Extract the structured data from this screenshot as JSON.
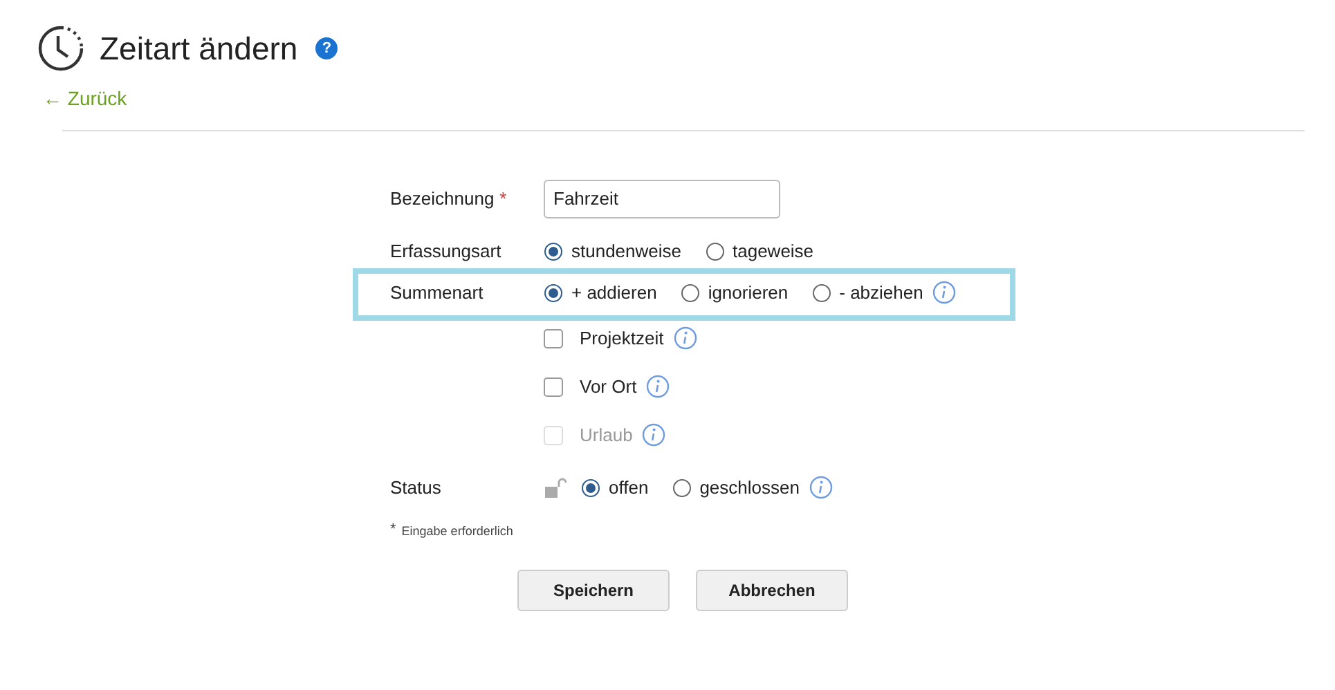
{
  "header": {
    "title": "Zeitart ändern",
    "help": "?",
    "back_link": "← Zurück"
  },
  "form": {
    "fields": [
      {
        "kind": "text",
        "label": "Bezeichnung",
        "required": true,
        "value": "Fahrzeit"
      },
      {
        "kind": "radio",
        "label": "Erfassungsart",
        "info": false,
        "options": [
          {
            "label": "stundenweise",
            "selected": true
          },
          {
            "label": "tageweise",
            "selected": false
          }
        ]
      },
      {
        "kind": "radio",
        "label": "Summenart",
        "info": true,
        "options": [
          {
            "label": "+ addieren",
            "selected": true
          },
          {
            "label": "ignorieren",
            "selected": false
          },
          {
            "label": "- abziehen",
            "selected": false
          }
        ]
      },
      {
        "kind": "checkbox",
        "label": "Projektzeit",
        "checked": false,
        "disabled": false,
        "info": true
      },
      {
        "kind": "checkbox",
        "label": "Vor Ort",
        "checked": false,
        "disabled": false,
        "info": true
      },
      {
        "kind": "checkbox",
        "label": "Urlaub",
        "checked": false,
        "disabled": true,
        "info": true
      },
      {
        "kind": "status",
        "label": "Status",
        "locked": false,
        "info": true,
        "options": [
          {
            "label": "offen",
            "selected": true
          },
          {
            "label": "geschlossen",
            "selected": false
          }
        ]
      }
    ],
    "required_note": "Eingabe erforderlich",
    "required_mark": "*",
    "buttons": [
      "Speichern",
      "Abbrechen"
    ]
  },
  "highlight": {
    "kind": "box"
  }
}
